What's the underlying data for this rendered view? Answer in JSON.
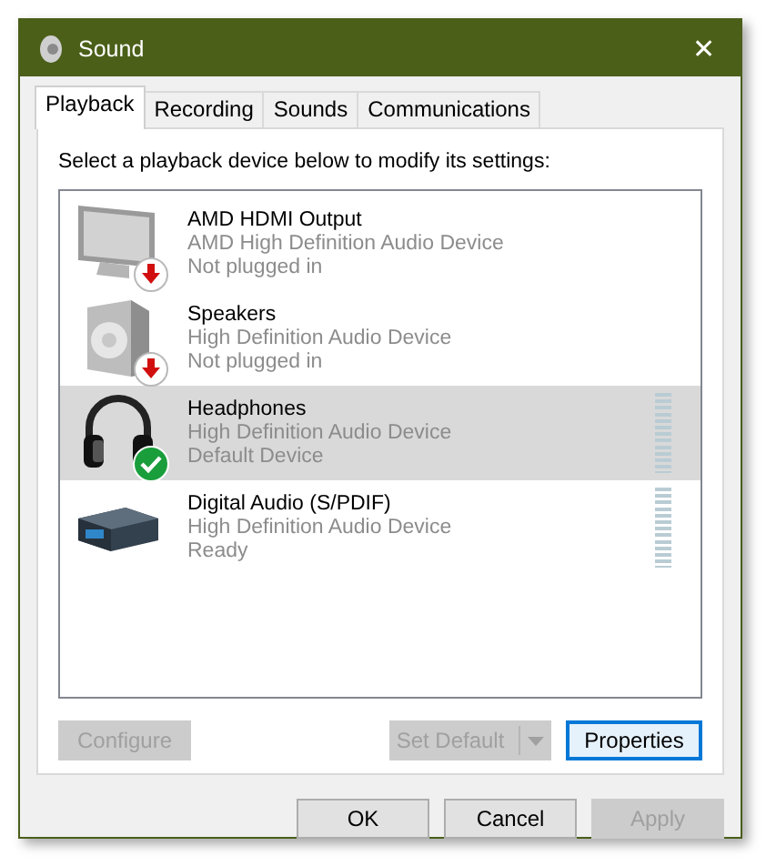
{
  "window": {
    "title": "Sound",
    "close": "✕"
  },
  "tabs": [
    {
      "label": "Playback",
      "selected": true
    },
    {
      "label": "Recording",
      "selected": false
    },
    {
      "label": "Sounds",
      "selected": false
    },
    {
      "label": "Communications",
      "selected": false
    }
  ],
  "instruction": "Select a playback device below to modify its settings:",
  "devices": [
    {
      "kind": "monitor",
      "name": "AMD HDMI Output",
      "driver": "AMD High Definition Audio Device",
      "state": "Not plugged in",
      "unplugged": true,
      "is_default": false,
      "selected": false
    },
    {
      "kind": "speaker",
      "name": "Speakers",
      "driver": "High Definition Audio Device",
      "state": "Not plugged in",
      "unplugged": true,
      "is_default": false,
      "selected": false
    },
    {
      "kind": "headphones",
      "name": "Headphones",
      "driver": "High Definition Audio Device",
      "state": "Default Device",
      "unplugged": false,
      "is_default": true,
      "selected": true,
      "level": 0
    },
    {
      "kind": "digital",
      "name": "Digital Audio (S/PDIF)",
      "driver": "High Definition Audio Device",
      "state": "Ready",
      "unplugged": false,
      "is_default": false,
      "selected": false,
      "level": 0
    }
  ],
  "device_buttons": [
    {
      "label": "Configure",
      "disabled": true,
      "focused": false,
      "dropdown": false
    },
    {
      "label": "Set Default",
      "disabled": true,
      "focused": false,
      "dropdown": true
    },
    {
      "label": "Properties",
      "disabled": false,
      "focused": true,
      "dropdown": false
    }
  ],
  "dialog_buttons": [
    {
      "label": "OK",
      "disabled": false
    },
    {
      "label": "Cancel",
      "disabled": false
    },
    {
      "label": "Apply",
      "disabled": true
    }
  ]
}
